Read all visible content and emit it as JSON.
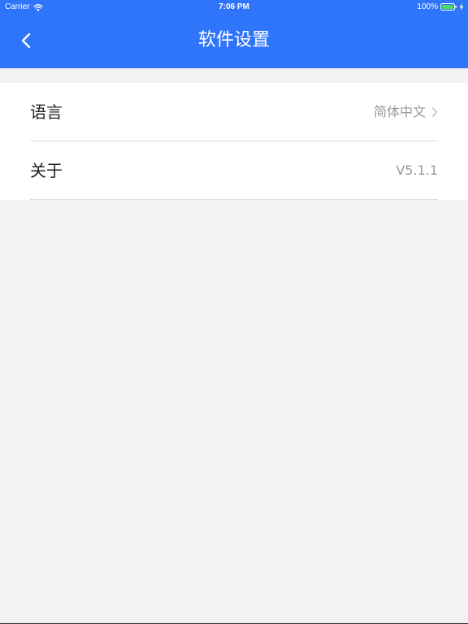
{
  "status_bar": {
    "carrier": "Carrier",
    "time": "7:06 PM",
    "battery": "100%",
    "icons": [
      "wifi-icon",
      "battery-icon",
      "charging-bolt-icon"
    ]
  },
  "nav": {
    "title": "软件设置",
    "back_icon": "chevron-left-icon"
  },
  "settings": {
    "items": [
      {
        "label": "语言",
        "value": "简体中文",
        "has_chevron": true
      },
      {
        "label": "关于",
        "value": "V5.1.1",
        "has_chevron": false
      }
    ]
  },
  "colors": {
    "header": "#2f75fb",
    "background": "#f2f2f2",
    "row_background": "#ffffff",
    "value_text": "#9a9a9a",
    "battery_fill": "#4cd964"
  }
}
